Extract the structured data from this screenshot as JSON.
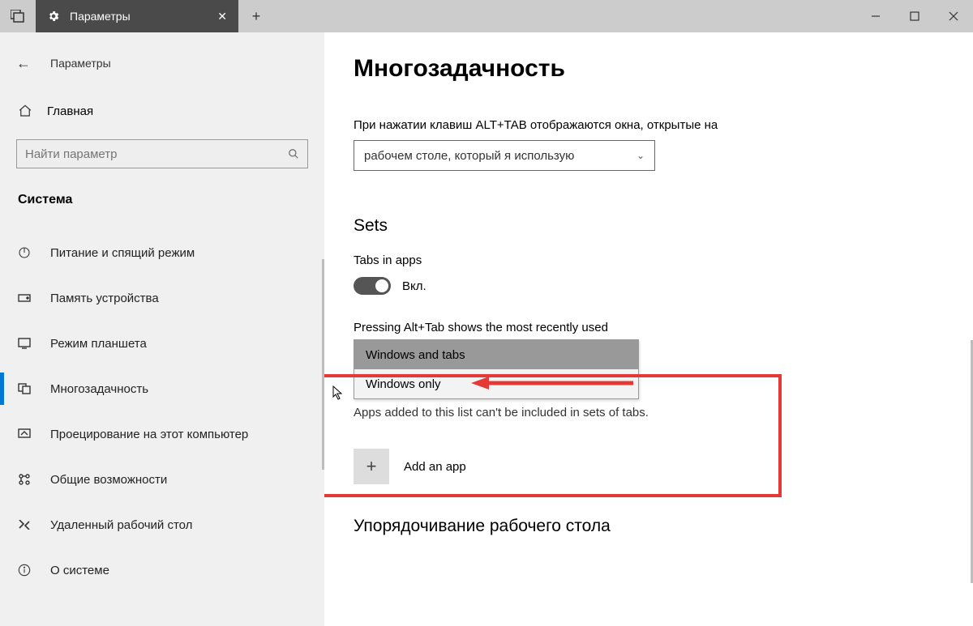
{
  "tab": {
    "title": "Параметры"
  },
  "header": {
    "back_label": "Параметры"
  },
  "sidebar": {
    "home": "Главная",
    "search_placeholder": "Найти параметр",
    "section": "Система",
    "items": [
      {
        "label": "Питание и спящий режим"
      },
      {
        "label": "Память устройства"
      },
      {
        "label": "Режим планшета"
      },
      {
        "label": "Многозадачность"
      },
      {
        "label": "Проецирование на этот компьютер"
      },
      {
        "label": "Общие возможности"
      },
      {
        "label": "Удаленный рабочий стол"
      },
      {
        "label": "О системе"
      }
    ]
  },
  "main": {
    "title": "Многозадачность",
    "alt_tab_label": "При нажатии клавиш ALT+TAB отображаются окна, открытые на",
    "alt_tab_value": "рабочем столе, который я использую",
    "sets_heading": "Sets",
    "tabs_in_apps": "Tabs in apps",
    "toggle_state": "Вкл.",
    "pressing_label": "Pressing Alt+Tab shows the most recently used",
    "dd_options": [
      "Windows and tabs",
      "Windows only"
    ],
    "excluded_text": "Apps added to this list can't be included in sets of tabs.",
    "add_app": "Add an app",
    "arrange_heading": "Упорядочивание рабочего стола"
  }
}
